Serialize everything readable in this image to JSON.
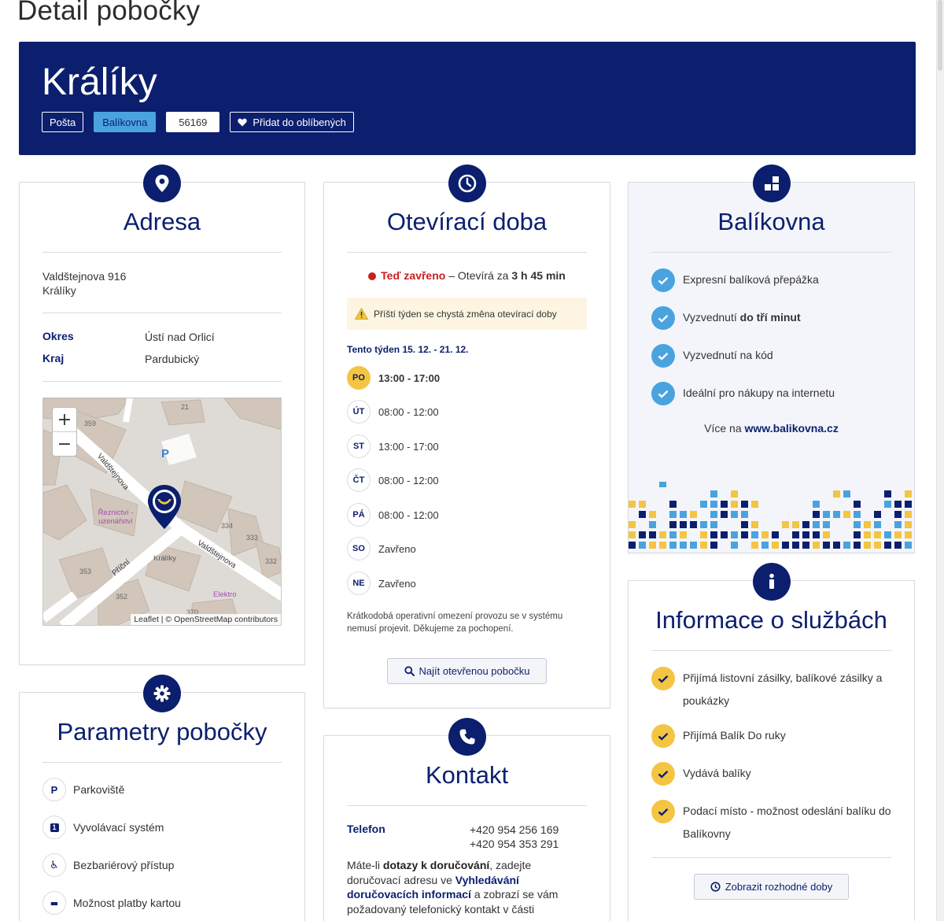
{
  "page": {
    "heading": "Detail pobočky"
  },
  "hero": {
    "title": "Králíky",
    "tags": {
      "posta": "Pošta",
      "balikovna": "Balíkovna",
      "code": "56169",
      "favorite": "Přidat do oblíbených"
    }
  },
  "address": {
    "title": "Adresa",
    "street": "Valdštejnova 916",
    "town": "Králíky",
    "district_label": "Okres",
    "district_value": "Ústí nad Orlicí",
    "region_label": "Kraj",
    "region_value": "Pardubický",
    "map": {
      "zoom_in": "+",
      "zoom_out": "−",
      "attribution_leaflet": "Leaflet",
      "attribution_rest": " | © OpenStreetMap contributors",
      "labels": {
        "street_valdstejnova": "Valdštejnova",
        "street_valdstejnova2": "Valdštejnova",
        "street_pricni": "Příční",
        "butcher": "Řeznictví - uzenářství",
        "town": "Králíky",
        "elektro": "Elektro",
        "parking": "P",
        "n359": "359",
        "n21": "21",
        "n334": "334",
        "n333": "333",
        "n332": "332",
        "n353": "353",
        "n352": "352",
        "n370": "370"
      }
    }
  },
  "hours": {
    "title": "Otevírací doba",
    "status_closed": "Teď zavřeno",
    "status_dash": " – Otevírá za ",
    "status_time": "3 h 45 min",
    "warning": "Příští týden se chystá změna otevírací doby",
    "week_label": "Tento týden 15. 12. - 21. 12.",
    "days": [
      {
        "day": "PO",
        "hours": "13:00 - 17:00"
      },
      {
        "day": "ÚT",
        "hours": "08:00 - 12:00"
      },
      {
        "day": "ST",
        "hours": "13:00 - 17:00"
      },
      {
        "day": "ČT",
        "hours": "08:00 - 12:00"
      },
      {
        "day": "PÁ",
        "hours": "08:00 - 12:00"
      },
      {
        "day": "SO",
        "hours": "Zavřeno"
      },
      {
        "day": "NE",
        "hours": "Zavřeno"
      }
    ],
    "note": "Krátkodobá operativní omezení provozu se v systému nemusí projevit. Děkujeme za pochopení.",
    "find_button": "Najít otevřenou pobočku"
  },
  "balikovna": {
    "title": "Balíkovna",
    "features": [
      {
        "text": "Expresní balíková přepážka",
        "bold": ""
      },
      {
        "text": "Vyzvednutí ",
        "bold": "do tří minut"
      },
      {
        "text": "Vyzvednutí na kód",
        "bold": ""
      },
      {
        "text": "Ideální pro nákupy na internetu",
        "bold": ""
      }
    ],
    "more_prefix": "Více na ",
    "more_link": "www.balikovna.cz"
  },
  "params": {
    "title": "Parametry pobočky",
    "items": [
      {
        "icon": "P",
        "text": "Parkoviště"
      },
      {
        "icon": "1",
        "text": "Vyvolávací systém"
      },
      {
        "icon": "♿",
        "text": "Bezbariérový přístup"
      },
      {
        "icon": "▬",
        "text": "Možnost platby kartou"
      }
    ]
  },
  "contact": {
    "title": "Kontakt",
    "phone_label": "Telefon",
    "phone_1": "+420 954 256 169",
    "phone_2": "+420 954 353 291",
    "p1": "Máte-li ",
    "b1": "dotazy k doručování",
    "p2": ", zadejte doručovací adresu ve ",
    "b2": "Vyhledávání doručovacích informací",
    "p3": " a zobrazí se vám požadovaný telefonický kontakt v části"
  },
  "services": {
    "title": "Informace o službách",
    "items": [
      "Přijímá listovní zásilky, balíkové zásilky a poukázky",
      "Přijímá Balík Do ruky",
      "Vydává balíky",
      "Podací místo - možnost odeslání balíku do Balíkovny"
    ],
    "decisive_button": "Zobrazit rozhodné doby"
  },
  "colors": {
    "brand": "#0b1f6e",
    "accent_blue": "#4aa3df",
    "accent_yellow": "#f4c542",
    "closed_red": "#c8201e"
  }
}
